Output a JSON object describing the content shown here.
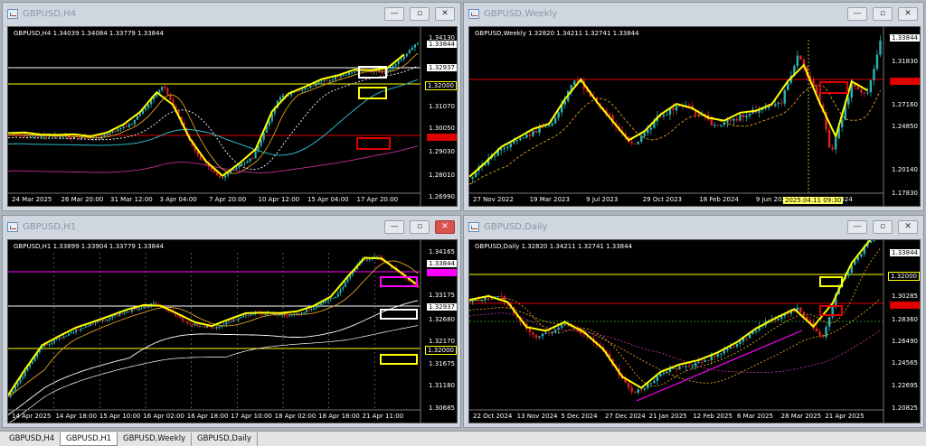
{
  "windows": [
    {
      "id": "h4",
      "title": "GBPUSD,H4",
      "header": "GBPUSD,H4  1.34039 1.34084 1.33779 1.33844",
      "yticks": [
        "1.34130",
        "1.33844",
        "1.32937",
        "1.32000",
        "1.31070",
        "1.30050",
        "1.29030",
        "1.28010",
        "1.26990"
      ],
      "xticks": [
        "24 Mar 2025",
        "26 Mar 20:00",
        "31 Mar 12:00",
        "3 Apr 04:00",
        "7 Apr 20:00",
        "10 Apr 12:00",
        "15 Apr 04:00",
        "17 Apr 20:00"
      ],
      "price_boxes": [
        {
          "label": "1.33844",
          "style": "white"
        },
        {
          "label": "1.32937",
          "style": "white"
        },
        {
          "label": "1.32000",
          "style": "yellow"
        },
        {
          "label": "1.29700",
          "style": "red"
        }
      ]
    },
    {
      "id": "weekly",
      "title": "GBPUSD,Weekly",
      "header": "GBPUSD,Weekly  1.32820 1.34211 1.32741 1.33844",
      "yticks": [
        "1.33844",
        "1.31830",
        "1.27160",
        "1.24850",
        "1.20140",
        "1.17830"
      ],
      "xticks": [
        "27 Nov 2022",
        "19 Mar 2023",
        "9 Jul 2023",
        "29 Oct 2023",
        "18 Feb 2024",
        "9 Jun 2024",
        "29 Sep 2024"
      ],
      "time_tag": "2025.04.11 09:30",
      "price_boxes": [
        {
          "label": "1.33844",
          "style": "white"
        },
        {
          "label": "1.29700",
          "style": "red"
        }
      ]
    },
    {
      "id": "h1",
      "title": "GBPUSD,H1",
      "header": "GBPUSD,H1  1.33899 1.33904 1.33779 1.33844",
      "yticks": [
        "1.34165",
        "1.33844",
        "1.33661",
        "1.33175",
        "1.32937",
        "1.32680",
        "1.32170",
        "1.32000",
        "1.31675",
        "1.31180",
        "1.30685"
      ],
      "xticks": [
        "14 Apr 2025",
        "14 Apr 18:00",
        "15 Apr 10:00",
        "16 Apr 02:00",
        "16 Apr 18:00",
        "17 Apr 10:00",
        "18 Apr 02:00",
        "18 Apr 18:00",
        "21 Apr 11:00"
      ],
      "price_boxes": [
        {
          "label": "1.33844",
          "style": "white"
        },
        {
          "label": "1.33661",
          "style": "mag"
        },
        {
          "label": "1.32937",
          "style": "white"
        },
        {
          "label": "1.32000",
          "style": "yellow"
        }
      ]
    },
    {
      "id": "daily",
      "title": "GBPUSD,Daily",
      "header": "GBPUSD,Daily  1.32820 1.34211 1.32741 1.33844",
      "yticks": [
        "1.33844",
        "1.32000",
        "1.30285",
        "1.29700",
        "1.28360",
        "1.26490",
        "1.24565",
        "1.22695",
        "1.20825"
      ],
      "xticks": [
        "22 Oct 2024",
        "13 Nov 2024",
        "5 Dec 2024",
        "27 Dec 2024",
        "21 Jan 2025",
        "12 Feb 2025",
        "6 Mar 2025",
        "28 Mar 2025",
        "21 Apr 2025"
      ],
      "price_boxes": [
        {
          "label": "1.33844",
          "style": "white"
        },
        {
          "label": "1.32000",
          "style": "yellow"
        },
        {
          "label": "1.29700",
          "style": "red"
        }
      ]
    }
  ],
  "tabs": [
    "GBPUSD,H4",
    "GBPUSD,H1",
    "GBPUSD,Weekly",
    "GBPUSD,Daily"
  ],
  "active_tab": "GBPUSD,H1",
  "colors": {
    "bull": "#2ab0b0",
    "bear": "#e02020",
    "zigzag": "#ffff00",
    "level_red": "#e00000",
    "level_yellow": "#ffff00",
    "level_magenta": "#ff00ff",
    "ma_cyan": "#2fb8c8",
    "ma_white": "#ffffff",
    "ma_orange": "#e0a020",
    "ma_purple": "#c0309a"
  }
}
